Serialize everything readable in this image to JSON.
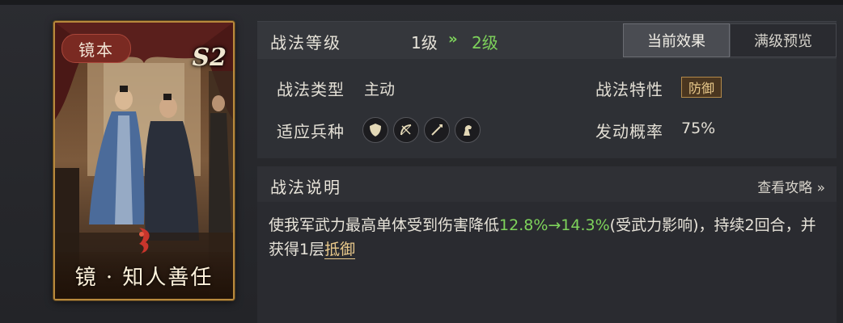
{
  "card": {
    "tag": "镜本",
    "badge": "S2",
    "name": "镜 · 知人善任",
    "art_icon": "two-figures-bowing-illustration",
    "emblem_icon": "red-feather-emblem-icon"
  },
  "level": {
    "title": "战法等级",
    "from": "1级",
    "arrow": "»",
    "to": "2级",
    "to_color": "#7ed35b"
  },
  "tabs": [
    {
      "label": "当前效果",
      "active": true
    },
    {
      "label": "满级预览",
      "active": false
    }
  ],
  "info": {
    "type_label": "战法类型",
    "type_value": "主动",
    "trait_label": "战法特性",
    "trait_value": "防御",
    "troops_label": "适应兵种",
    "troop_icons": [
      "shield-troop-icon",
      "bow-troop-icon",
      "spear-troop-icon",
      "cavalry-horse-icon"
    ],
    "rate_label": "发动概率",
    "rate_value": "75%"
  },
  "description": {
    "title": "战法说明",
    "guide_link": "查看攻略 »",
    "text_part1": "使我军武力最高单体受到伤害降低",
    "text_highlight": "12.8%→14.3%",
    "text_part2": "(受武力影响)，持续2回合，并获得1层",
    "text_keyword": "抵御",
    "highlight_color": "#7ed35b"
  }
}
